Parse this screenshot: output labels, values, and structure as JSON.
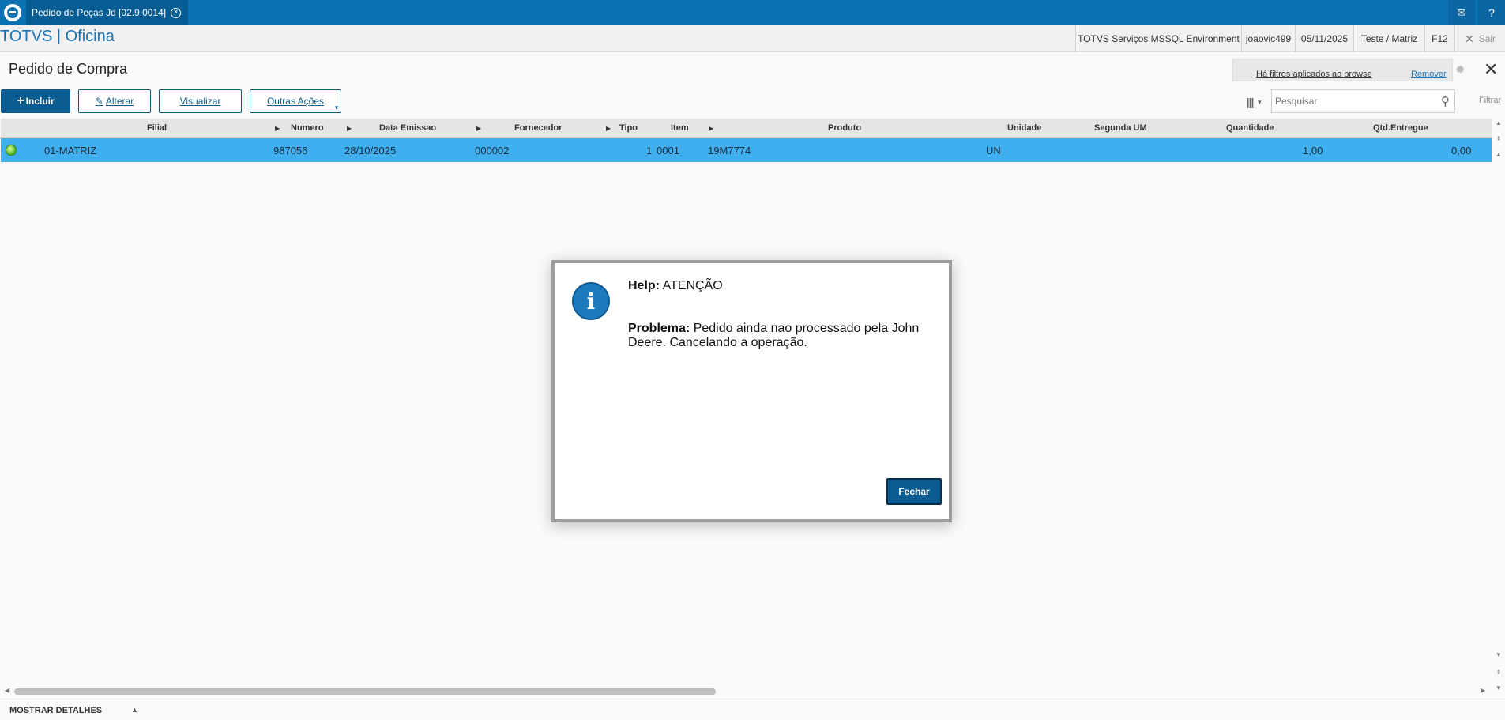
{
  "tab": {
    "title": "Pedido de Peças Jd [02.9.0014]"
  },
  "app": {
    "title": "TOTVS | Oficina"
  },
  "env": {
    "environment": "TOTVS Serviços MSSQL Environment",
    "user": "joaovic499",
    "date": "05/11/2025",
    "company": "Teste / Matriz",
    "shortcut": "F12",
    "logout": "Sair"
  },
  "page": {
    "title": "Pedido de Compra"
  },
  "filters": {
    "applied_text": "Há filtros aplicados ao browse",
    "remove_label": "Remover"
  },
  "toolbar": {
    "include_label": "Incluir",
    "edit_label": "Alterar",
    "view_label": "Visualizar",
    "other_label": "Outras Ações"
  },
  "search": {
    "placeholder": "Pesquisar",
    "filter_label": "Filtrar"
  },
  "grid": {
    "columns": [
      "Filial",
      "Numero",
      "Data Emissao",
      "Fornecedor",
      "Tipo",
      "Item",
      "Produto",
      "Unidade",
      "Segunda UM",
      "Quantidade",
      "Qtd.Entregue"
    ],
    "rows": [
      {
        "filial": "01-MATRIZ",
        "numero": "987056",
        "data": "28/10/2025",
        "fornecedor": "000002",
        "tipo": "1",
        "item": "0001",
        "produto": "19M7774",
        "unidade": "UN",
        "segunda_um": "",
        "quantidade": "1,00",
        "qtd_entregue": "0,00"
      }
    ]
  },
  "footer": {
    "details_label": "MOSTRAR DETALHES"
  },
  "dialog": {
    "title_label": "Help:",
    "title_value": "ATENÇÃO",
    "problem_label": "Problema:",
    "problem_text": "Pedido ainda nao processado pela John Deere. Cancelando a operação.",
    "close_label": "Fechar"
  },
  "colors": {
    "accent": "#0a72b3",
    "button": "#0b5d91",
    "selected_row": "#40aff0"
  }
}
